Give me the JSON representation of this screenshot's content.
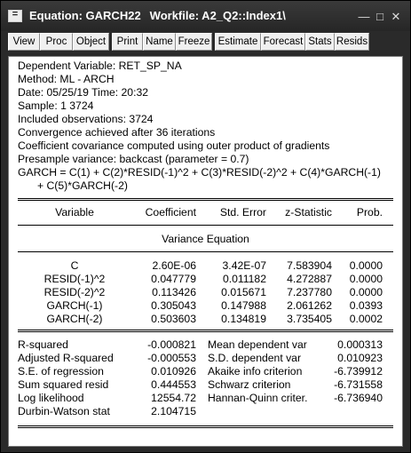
{
  "window": {
    "icon_letter": "=",
    "title_object": "Equation: GARCH22",
    "title_workfile": "Workfile: A2_Q2::Index1\\",
    "minimize_glyph": "—",
    "maximize_glyph": "□",
    "close_glyph": "✕"
  },
  "toolbar": {
    "buttons": [
      "View",
      "Proc",
      "Object",
      "Print",
      "Name",
      "Freeze",
      "Estimate",
      "Forecast",
      "Stats",
      "Resids"
    ]
  },
  "header": {
    "lines": [
      "Dependent Variable: RET_SP_NA",
      "Method: ML - ARCH",
      "Date: 05/25/19   Time: 20:32",
      "Sample: 1 3724",
      "Included observations: 3724",
      "Convergence achieved after 36 iterations",
      "Coefficient covariance computed using outer product of gradients",
      "Presample variance: backcast (parameter = 0.7)",
      "GARCH = C(1) + C(2)*RESID(-1)^2 + C(3)*RESID(-2)^2 + C(4)*GARCH(-1)",
      "+ C(5)*GARCH(-2)"
    ]
  },
  "table": {
    "columns": [
      "Variable",
      "Coefficient",
      "Std. Error",
      "z-Statistic",
      "Prob."
    ],
    "section_title": "Variance Equation",
    "rows": [
      [
        "C",
        "2.60E-06",
        "3.42E-07",
        "7.583904",
        "0.0000"
      ],
      [
        "RESID(-1)^2",
        "0.047779",
        "0.011182",
        "4.272887",
        "0.0000"
      ],
      [
        "RESID(-2)^2",
        "0.113426",
        "0.015671",
        "7.237780",
        "0.0000"
      ],
      [
        "GARCH(-1)",
        "0.305043",
        "0.147988",
        "2.061262",
        "0.0393"
      ],
      [
        "GARCH(-2)",
        "0.503603",
        "0.134819",
        "3.735405",
        "0.0002"
      ]
    ]
  },
  "stats": {
    "left": [
      [
        "R-squared",
        "-0.000821"
      ],
      [
        "Adjusted R-squared",
        "-0.000553"
      ],
      [
        "S.E. of regression",
        "0.010926"
      ],
      [
        "Sum squared resid",
        "0.444553"
      ],
      [
        "Log likelihood",
        "12554.72"
      ],
      [
        "Durbin-Watson stat",
        "2.104715"
      ]
    ],
    "right": [
      [
        "Mean dependent var",
        "0.000313"
      ],
      [
        "S.D. dependent var",
        "0.010923"
      ],
      [
        "Akaike info criterion",
        "-6.739912"
      ],
      [
        "Schwarz criterion",
        "-6.731558"
      ],
      [
        "Hannan-Quinn criter.",
        "-6.736940"
      ]
    ]
  }
}
